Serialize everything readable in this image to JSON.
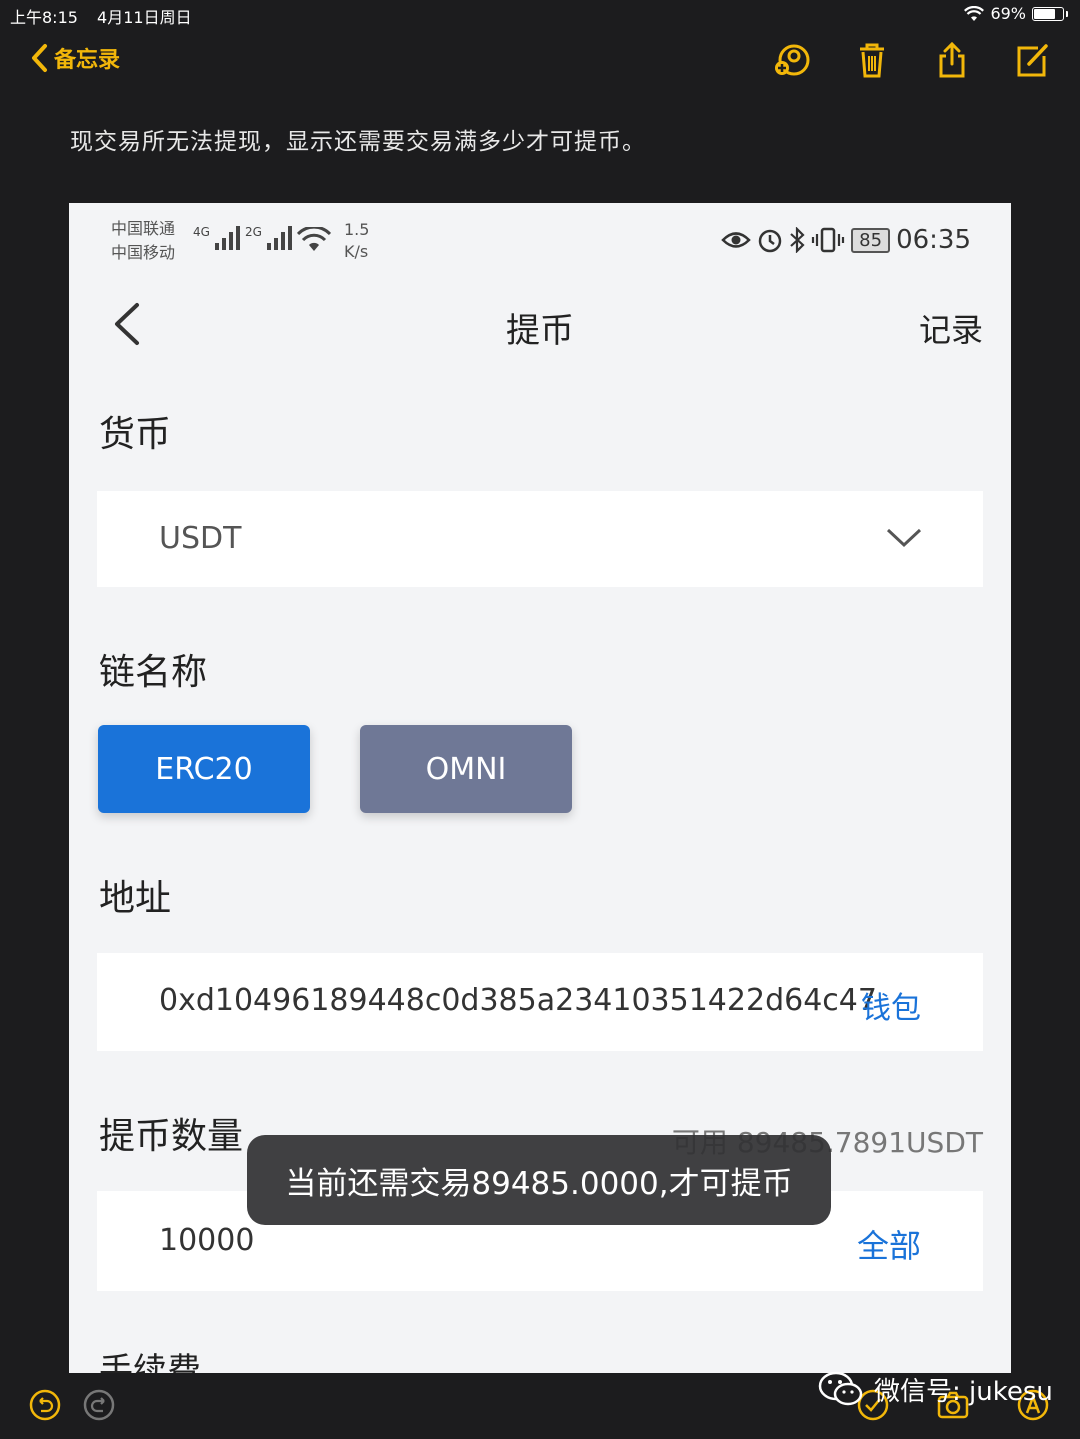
{
  "status_bar": {
    "time": "上午8:15",
    "date": "4月11日周日",
    "battery": "69%",
    "battery_level": 0.69
  },
  "notes_nav": {
    "back_label": "备忘录",
    "accent": "#f2b70a"
  },
  "note": {
    "text": "现交易所无法提现，显示还需要交易满多少才可提币。"
  },
  "phone": {
    "status": {
      "carrier1": "中国联通",
      "carrier2": "中国移动",
      "net1": "4G",
      "net2": "2G",
      "speed_value": "1.5",
      "speed_unit": "K/s",
      "battery": "85",
      "time": "06:35"
    },
    "header": {
      "title": "提币",
      "record": "记录"
    },
    "currency": {
      "label": "货币",
      "value": "USDT"
    },
    "chain": {
      "label": "链名称",
      "options": [
        "ERC20",
        "OMNI"
      ],
      "selected": "ERC20",
      "selected_color": "#1a73d9",
      "unselected_color": "#6f7896"
    },
    "address": {
      "label": "地址",
      "value": "0xd10496189448c0d385a23410351422d64c47",
      "wallet_link": "钱包"
    },
    "amount": {
      "label": "提币数量",
      "available": "可用 89485.7891USDT",
      "value": "10000",
      "all_link": "全部"
    },
    "toast": "当前还需交易89485.0000,才可提币",
    "fee": {
      "label": "手续费"
    }
  },
  "watermark": {
    "wechat": "微信号: jukesu"
  }
}
